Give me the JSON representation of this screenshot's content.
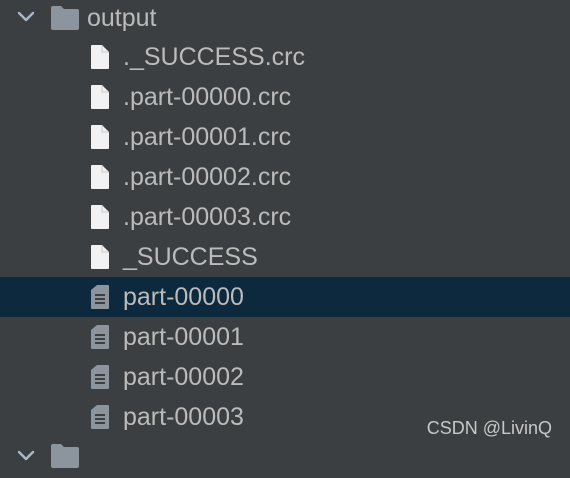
{
  "tree": {
    "folder": {
      "name": "output",
      "expanded": true,
      "icon": "folder-icon"
    },
    "files": [
      {
        "name": "._SUCCESS.crc",
        "icon": "blank-file-icon",
        "selected": false
      },
      {
        "name": ".part-00000.crc",
        "icon": "blank-file-icon",
        "selected": false
      },
      {
        "name": ".part-00001.crc",
        "icon": "blank-file-icon",
        "selected": false
      },
      {
        "name": ".part-00002.crc",
        "icon": "blank-file-icon",
        "selected": false
      },
      {
        "name": ".part-00003.crc",
        "icon": "blank-file-icon",
        "selected": false
      },
      {
        "name": "_SUCCESS",
        "icon": "blank-file-icon",
        "selected": false
      },
      {
        "name": "part-00000",
        "icon": "text-file-icon",
        "selected": true
      },
      {
        "name": "part-00001",
        "icon": "text-file-icon",
        "selected": false
      },
      {
        "name": "part-00002",
        "icon": "text-file-icon",
        "selected": false
      },
      {
        "name": "part-00003",
        "icon": "text-file-icon",
        "selected": false
      }
    ],
    "next_folder": {
      "expanded": false,
      "icon": "folder-icon"
    }
  },
  "watermark": "CSDN @LivinQ",
  "colors": {
    "background": "#3c3f41",
    "selection": "#0d293e",
    "text": "#bbbbbb",
    "folder_icon": "#8c959e",
    "file_icon": "#f2f2f2"
  }
}
